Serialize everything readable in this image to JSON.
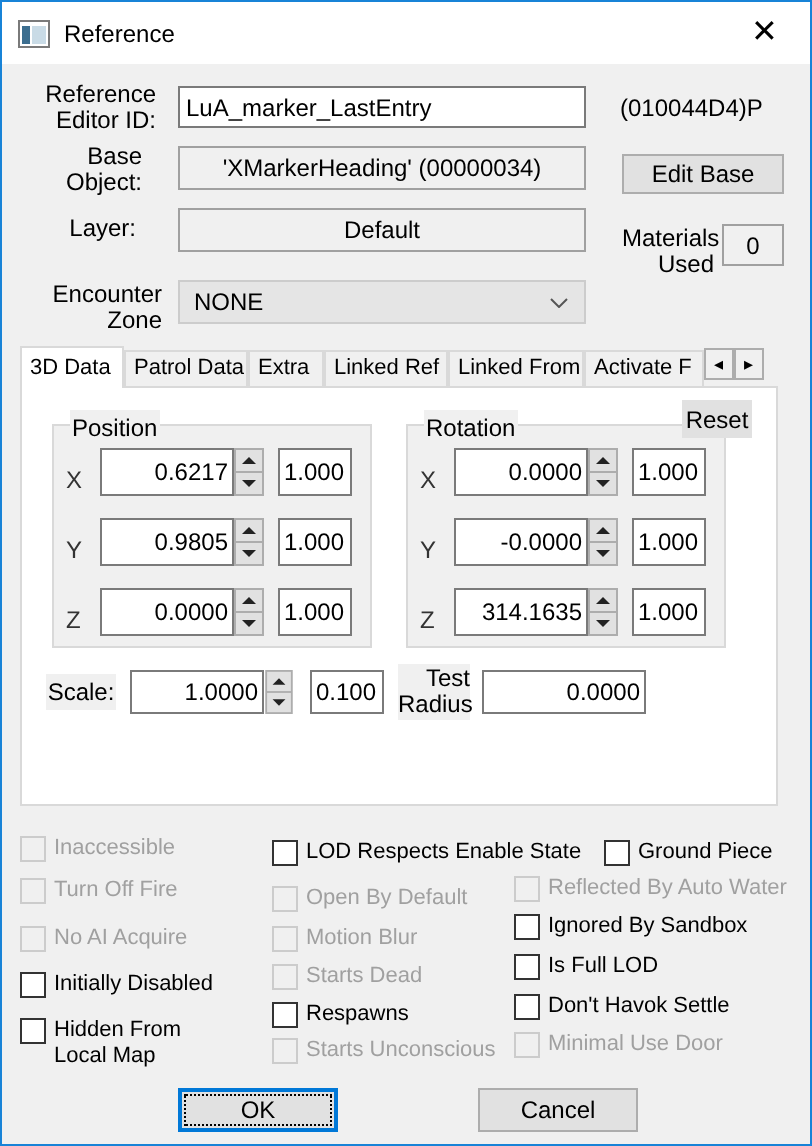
{
  "window": {
    "title": "Reference",
    "close": "✕"
  },
  "editor_id": {
    "label": "Reference Editor ID:",
    "value": "LuA_marker_LastEntry",
    "form_id": "(010044D4)P"
  },
  "base_object": {
    "label": "Base Object:",
    "value": "'XMarkerHeading' (00000034)",
    "button": "Edit Base"
  },
  "layer": {
    "label": "Layer:",
    "value": "Default"
  },
  "materials_used": {
    "label": "Materials Used",
    "value": "0"
  },
  "encounter_zone": {
    "label": "Encounter Zone",
    "value": "NONE"
  },
  "tabs": [
    {
      "label": "3D Data",
      "selected": true
    },
    {
      "label": "Patrol Data",
      "selected": false
    },
    {
      "label": "Extra",
      "selected": false
    },
    {
      "label": "Linked Ref",
      "selected": false
    },
    {
      "label": "Linked From",
      "selected": false
    },
    {
      "label": "Activate F",
      "selected": false
    }
  ],
  "tab_scroll": {
    "left": "◂",
    "right": "▸"
  },
  "position": {
    "title": "Position",
    "rows": [
      {
        "axis": "X",
        "value": "0.6217",
        "step": "1.000"
      },
      {
        "axis": "Y",
        "value": "0.9805",
        "step": "1.000"
      },
      {
        "axis": "Z",
        "value": "0.0000",
        "step": "1.000"
      }
    ]
  },
  "rotation": {
    "title": "Rotation",
    "reset": "Reset",
    "rows": [
      {
        "axis": "X",
        "value": "0.0000",
        "step": "1.000"
      },
      {
        "axis": "Y",
        "value": "-0.0000",
        "step": "1.000"
      },
      {
        "axis": "Z",
        "value": "314.1635",
        "step": "1.000"
      }
    ]
  },
  "scale": {
    "label": "Scale:",
    "value": "1.0000",
    "step": "0.100"
  },
  "test_radius": {
    "label": "Test Radius",
    "value": "0.0000"
  },
  "flags": {
    "column_1": [
      {
        "label": "Inaccessible",
        "checked": false,
        "disabled": true
      },
      {
        "label": "Turn Off Fire",
        "checked": false,
        "disabled": true
      },
      {
        "label": "No AI Acquire",
        "checked": false,
        "disabled": true
      },
      {
        "label": "Initially Disabled",
        "checked": false,
        "disabled": false
      },
      {
        "label": "Hidden From Local Map",
        "checked": false,
        "disabled": false
      }
    ],
    "column_2": [
      {
        "label": "LOD Respects Enable State",
        "checked": false,
        "disabled": false
      },
      {
        "label": "Open By Default",
        "checked": false,
        "disabled": true
      },
      {
        "label": "Motion Blur",
        "checked": false,
        "disabled": true
      },
      {
        "label": "Starts Dead",
        "checked": false,
        "disabled": true
      },
      {
        "label": "Respawns",
        "checked": false,
        "disabled": false
      },
      {
        "label": "Starts Unconscious",
        "checked": false,
        "disabled": true
      }
    ],
    "column_3": [
      {
        "label": "Ground Piece",
        "checked": false,
        "disabled": false
      },
      {
        "label": "Reflected By Auto Water",
        "checked": false,
        "disabled": true
      },
      {
        "label": "Ignored By Sandbox",
        "checked": false,
        "disabled": false
      },
      {
        "label": "Is Full LOD",
        "checked": false,
        "disabled": false
      },
      {
        "label": "Don't Havok Settle",
        "checked": false,
        "disabled": false
      },
      {
        "label": "Minimal Use Door",
        "checked": false,
        "disabled": true
      }
    ]
  },
  "buttons": [
    {
      "label": "OK",
      "focused": true
    },
    {
      "label": "Cancel",
      "focused": false
    }
  ]
}
